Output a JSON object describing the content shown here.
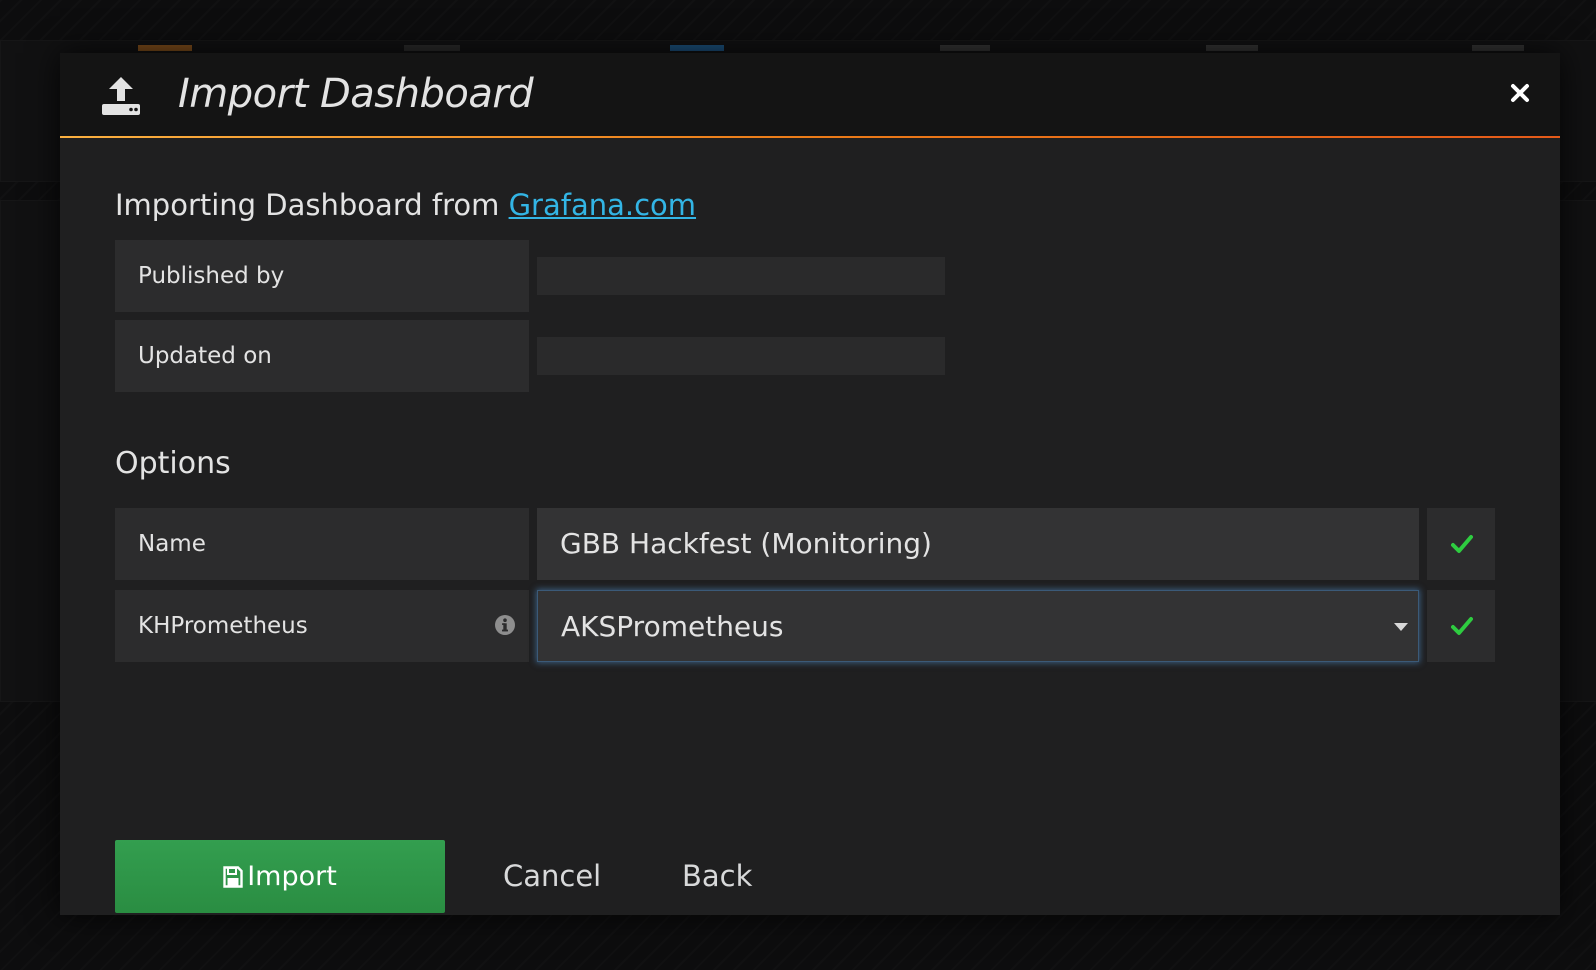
{
  "modal": {
    "title": "Import Dashboard",
    "close_icon": "close-icon",
    "header_icon": "upload-icon"
  },
  "source": {
    "prefix": "Importing Dashboard from ",
    "link_text": "Grafana.com"
  },
  "details": {
    "published_by_label": "Published by",
    "published_by_value": "",
    "updated_on_label": "Updated on",
    "updated_on_value": ""
  },
  "options": {
    "heading": "Options",
    "name_label": "Name",
    "name_value": "GBB Hackfest (Monitoring)",
    "datasource_label": "KHPrometheus",
    "datasource_value": "AKSPrometheus",
    "datasource_options": [
      "AKSPrometheus"
    ]
  },
  "actions": {
    "import_label": "Import",
    "cancel_label": "Cancel",
    "back_label": "Back"
  },
  "colors": {
    "accent_gradient_start": "#fbb040",
    "accent_gradient_end": "#e55a19",
    "link": "#33b5e5",
    "success": "#2ecc40",
    "import_button": "#2c9a46"
  }
}
